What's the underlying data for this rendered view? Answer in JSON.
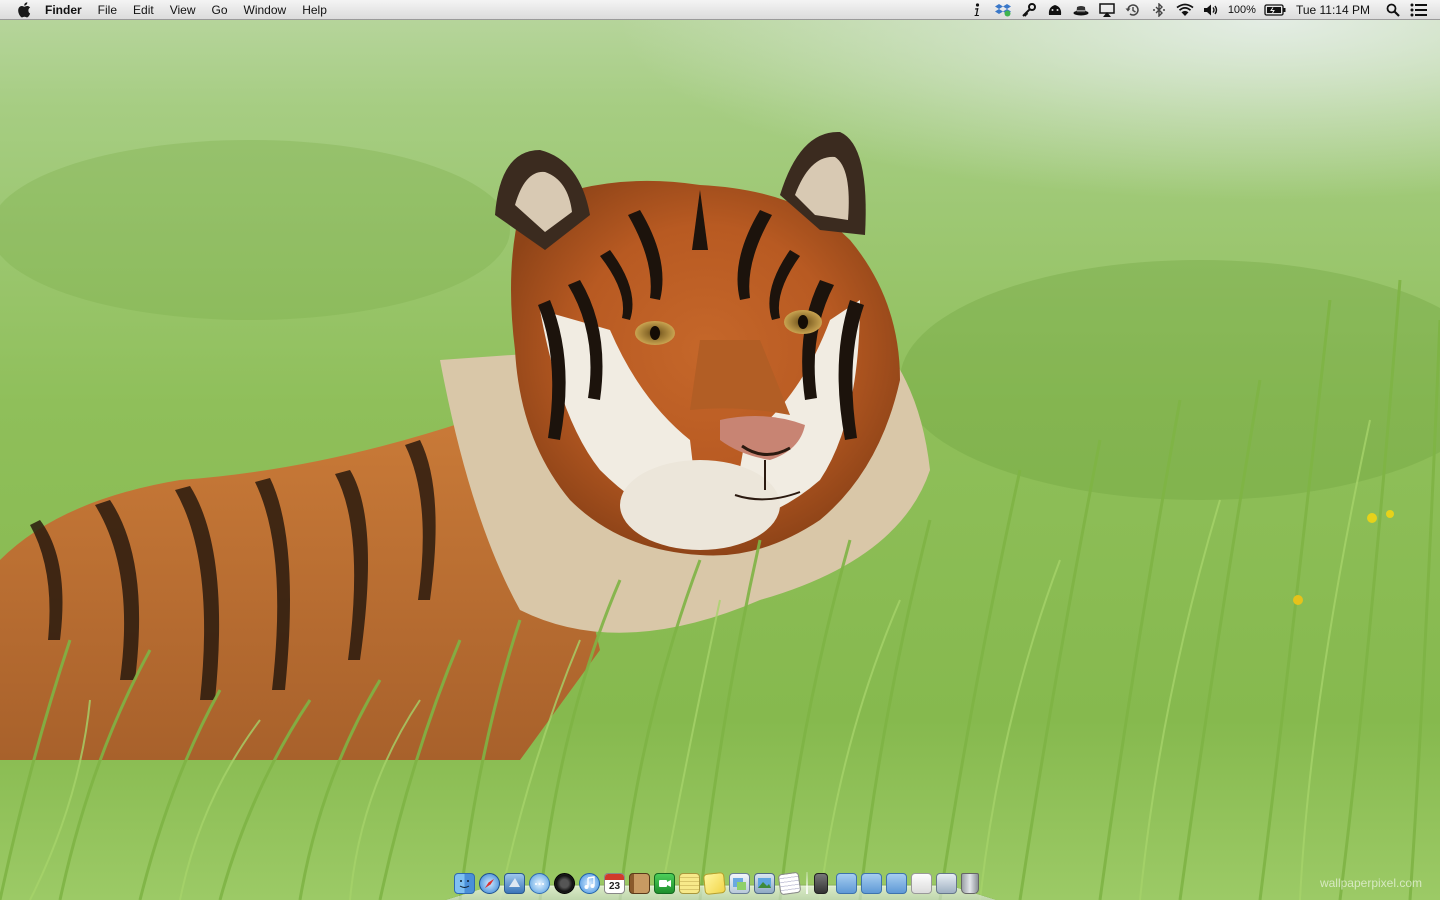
{
  "menubar": {
    "app_name": "Finder",
    "menus": [
      "File",
      "Edit",
      "View",
      "Go",
      "Window",
      "Help"
    ],
    "status_icons": [
      "info-icon",
      "dropbox-icon",
      "key-icon",
      "growl-icon",
      "hat-icon",
      "airplay-icon",
      "time-machine-icon",
      "bluetooth-icon",
      "wifi-icon",
      "volume-icon"
    ],
    "battery": "100%",
    "clock": "Tue 11:14 PM",
    "right_icons": [
      "spotlight-icon",
      "notification-list-icon"
    ]
  },
  "dock": {
    "apps": [
      "finder-icon",
      "safari-icon",
      "mail-icon",
      "ichat-icon",
      "photo-booth-icon",
      "itunes-icon",
      "ical-icon",
      "address-book-icon",
      "facetime-icon",
      "notes-icon",
      "stickies-icon",
      "preview-icon",
      "iphoto-icon",
      "textedit-icon"
    ],
    "ical_date": "23",
    "stacks": [
      "utilities-icon",
      "applications-folder-icon",
      "documents-folder-icon",
      "downloads-folder-icon",
      "document-stack-icon",
      "screen-icon",
      "trash-icon"
    ]
  },
  "watermark": "wallpaperpixel.com",
  "colors": {
    "grass": "#8fbf5a",
    "tiger_orange": "#c96a26",
    "menubar": "#e6e6e6"
  }
}
